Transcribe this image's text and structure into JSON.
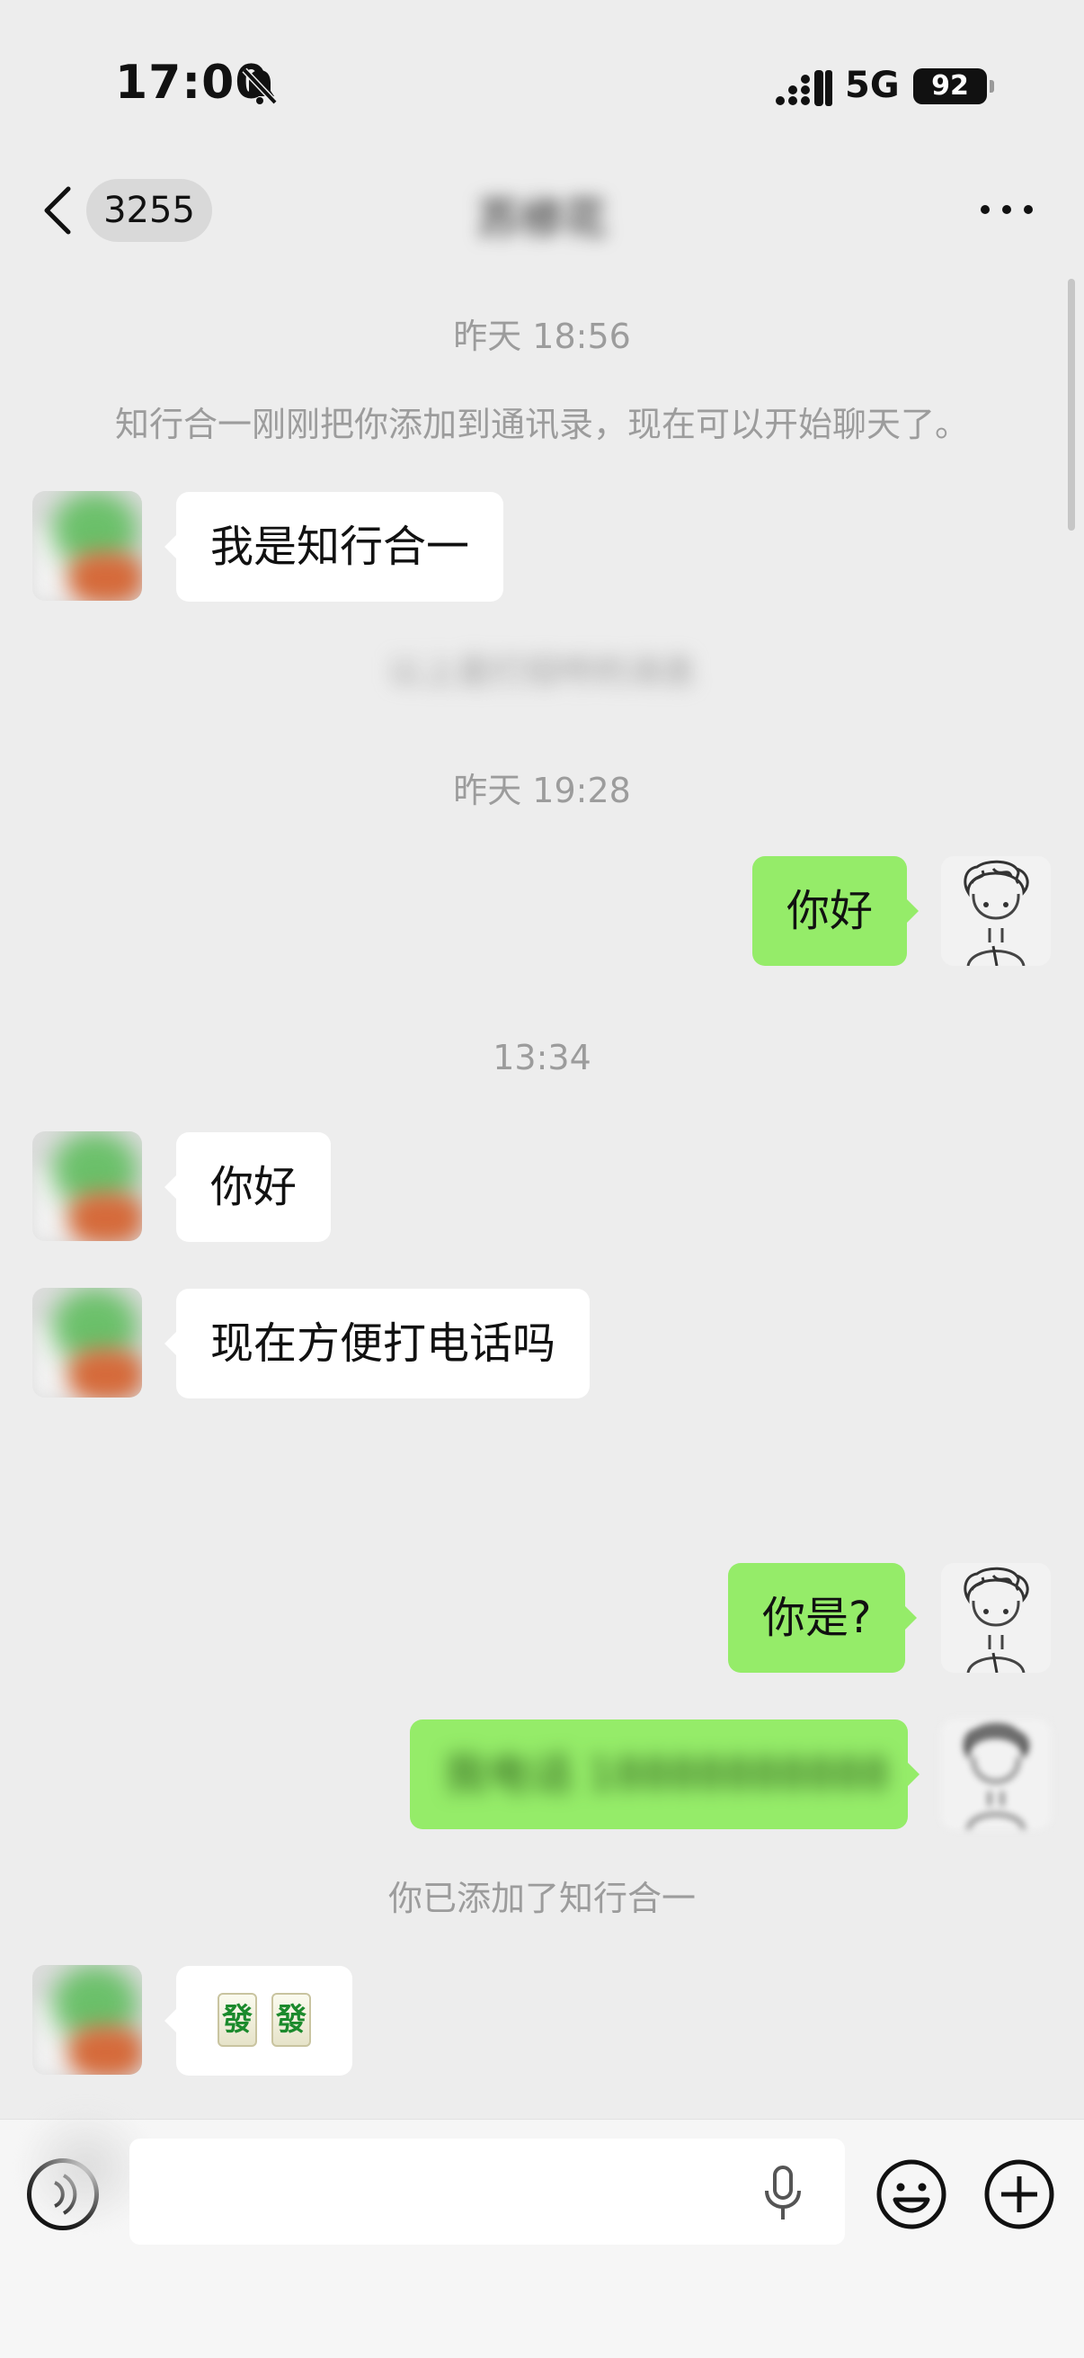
{
  "status_bar": {
    "time": "17:00",
    "network": "5G",
    "battery": "92"
  },
  "nav": {
    "unread_count": "3255",
    "title": "苏修花"
  },
  "messages": {
    "time_1": "昨天 18:56",
    "added_notice": "知行合一刚刚把你添加到通讯录，现在可以开始聊天了。",
    "in_intro": "我是知行合一",
    "hidden_notice": "以上是打招呼的消息",
    "time_2": "昨天 19:28",
    "out_hello": "你好",
    "time_3": "13:34",
    "in_hello": "你好",
    "in_call": "现在方便打电话吗",
    "out_who": "你是?",
    "out_phone": "我电话 18888888888",
    "you_added": "你已添加了知行合一",
    "in_tiles": [
      "發",
      "發"
    ]
  },
  "input": {
    "placeholder": ""
  },
  "colors": {
    "background": "#ededed",
    "bubble_out": "#95ec69",
    "bubble_in": "#ffffff",
    "system_text": "#9c9c9c"
  },
  "icons": [
    "bell-slash-icon",
    "signal-icon",
    "back-chevron-icon",
    "more-icon",
    "voice-icon",
    "mic-icon",
    "emoji-icon",
    "plus-icon"
  ]
}
